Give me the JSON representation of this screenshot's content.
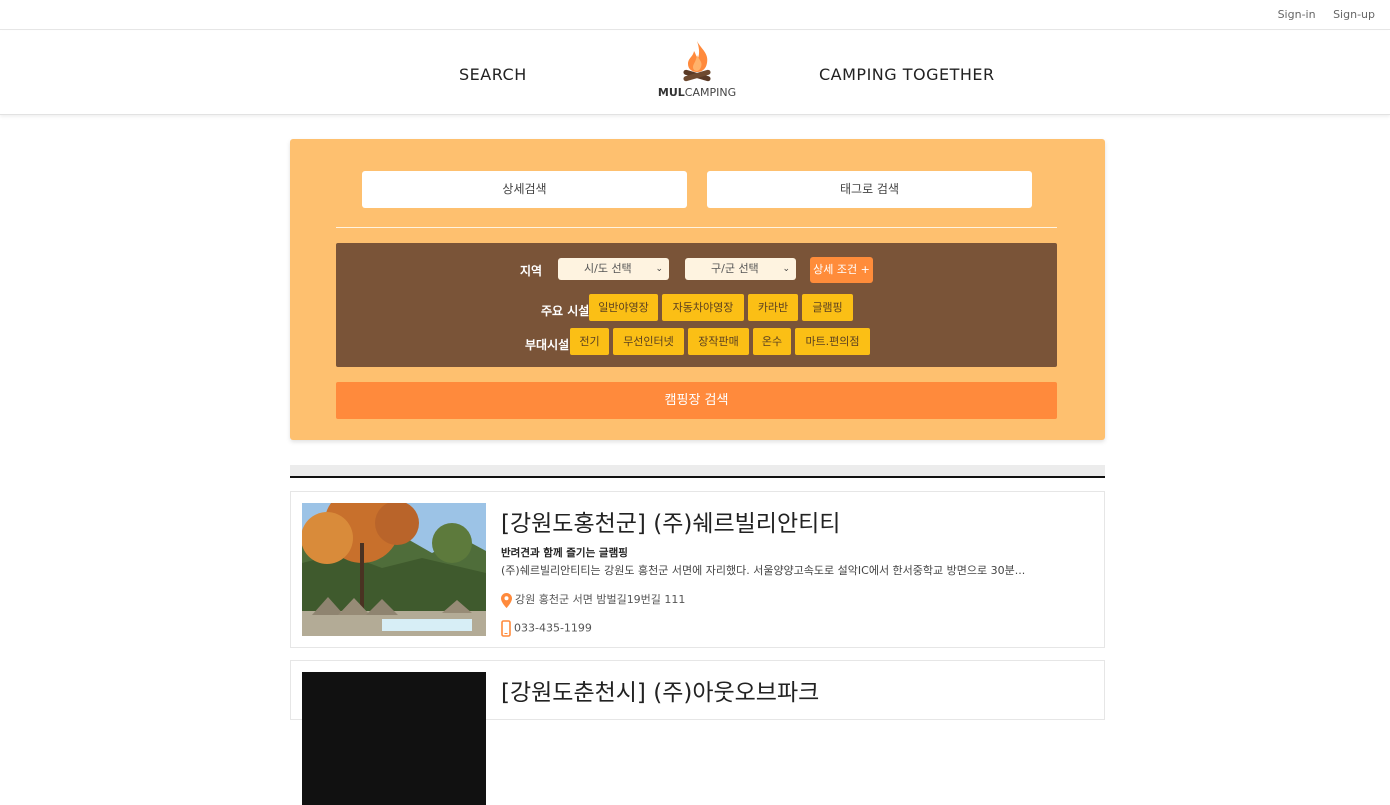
{
  "auth": {
    "signin": "Sign-in",
    "signup": "Sign-up"
  },
  "nav": {
    "left": "SEARCH",
    "right": "CAMPING TOGETHER"
  },
  "logo": {
    "bold": "MUL",
    "rest": "CAMPING"
  },
  "colors": {
    "panel": "#fec06f",
    "filter": "#7a5438",
    "accent": "#ff8a3c",
    "chip": "#fbbf15"
  },
  "search": {
    "tab_detail": "상세검색",
    "tab_tag": "태그로 검색",
    "region_label": "지역",
    "sido_select": "시/도 선택",
    "gugun_select": "구/군 선택",
    "detail_toggle": "상세 조건 +",
    "main_facility_label": "주요 시설",
    "main_facilities": [
      "일반야영장",
      "자동차야영장",
      "카라반",
      "글램핑"
    ],
    "sub_facility_label": "부대시설",
    "sub_facilities": [
      "전기",
      "무선인터넷",
      "장작판매",
      "온수",
      "마트.편의점"
    ],
    "submit": "캠핑장 검색"
  },
  "results": [
    {
      "title": "[강원도홍천군] (주)쉐르빌리안티티",
      "subtitle": "반려견과 함께 즐기는 글램핑",
      "desc": "(주)쉐르빌리안티티는 강원도 홍천군 서면에 자리했다. 서울양양고속도로 설악IC에서 한서중학교 방면으로 30분...",
      "address": "강원 홍천군 서면 밤벌길19번길 111",
      "phone": "033-435-1199"
    },
    {
      "title": "[강원도춘천시] (주)아웃오브파크"
    }
  ]
}
